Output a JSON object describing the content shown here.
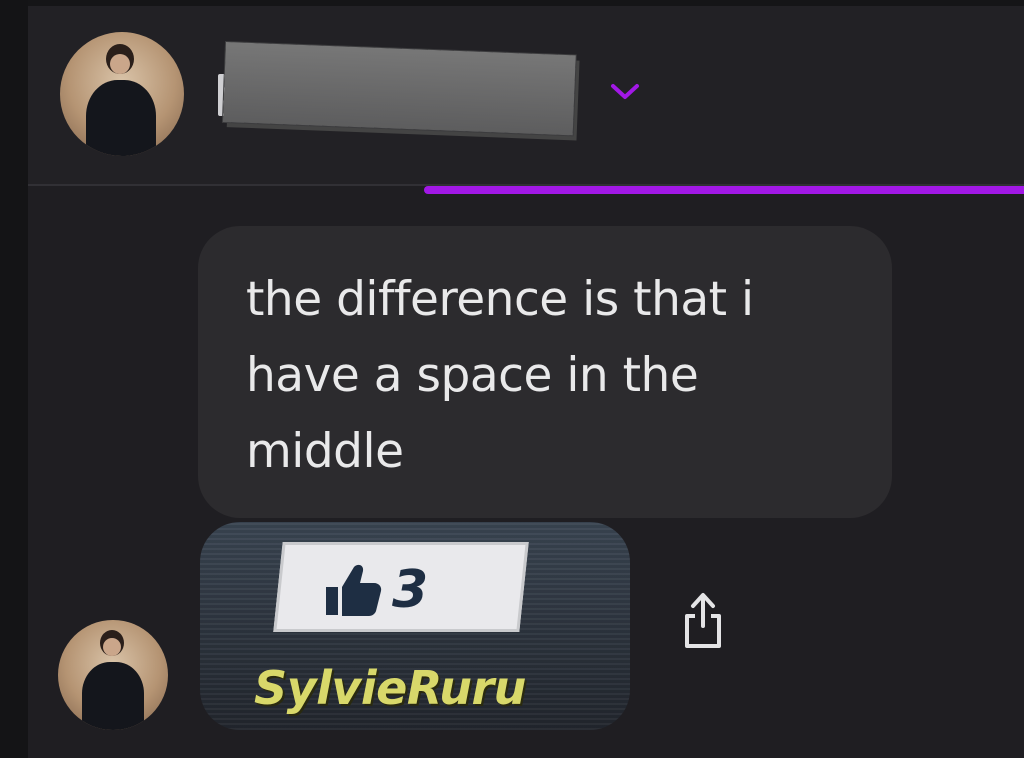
{
  "header": {
    "name_redacted": true
  },
  "message": {
    "lines": [
      "the difference is that i",
      "have a space in the",
      "middle"
    ]
  },
  "card": {
    "like_count": "3",
    "username": "SylvieRuru"
  },
  "colors": {
    "accent": "#a218e6",
    "bubble": "#2c2b2e",
    "background": "#1f1e22",
    "username": "#d8d86a"
  },
  "icons": {
    "chevron": "chevron-down-icon",
    "like": "thumbs-up-icon",
    "share": "share-icon"
  }
}
